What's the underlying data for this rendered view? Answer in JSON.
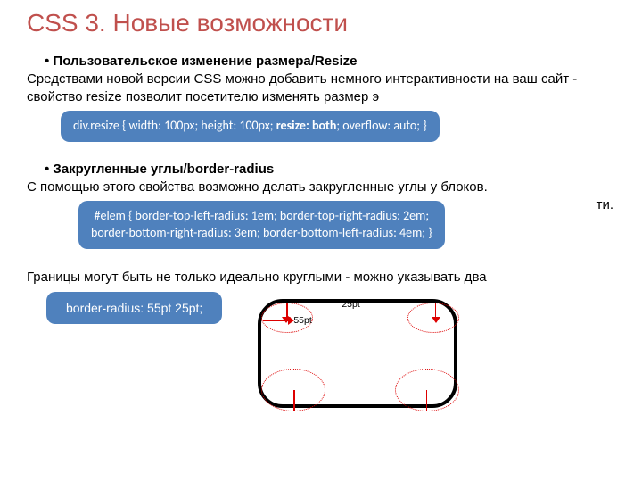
{
  "title": "CSS 3. Новые возможности",
  "resize": {
    "heading": "Пользовательское изменение размера/Resize",
    "text": "Средствами новой версии CSS можно  добавить немного интерактивности на ваш сайт - свойство resize позволит посетителю изменять размер э",
    "code_pre": "div.resize { width: 100px; height: 100px; ",
    "code_em": "resize: both",
    "code_post": "; overflow: auto; }"
  },
  "radius": {
    "heading": "Закругленные углы/border-radius",
    "text1": "С помощью этого свойства возможно делать закругленные углы у блоков.",
    "text1_tail": "ти.",
    "code_line1": "#elem { border-top-left-radius: 1em; border-top-right-radius: 2em;",
    "code_line2": "border-bottom-right-radius: 3em; border-bottom-left-radius: 4em; }"
  },
  "ellipse": {
    "text": "Границы могут быть не только идеально круглыми - можно указывать два",
    "code": "border-radius: 55pt 25pt;",
    "label_25": "25pt",
    "label_55": "55pt"
  }
}
